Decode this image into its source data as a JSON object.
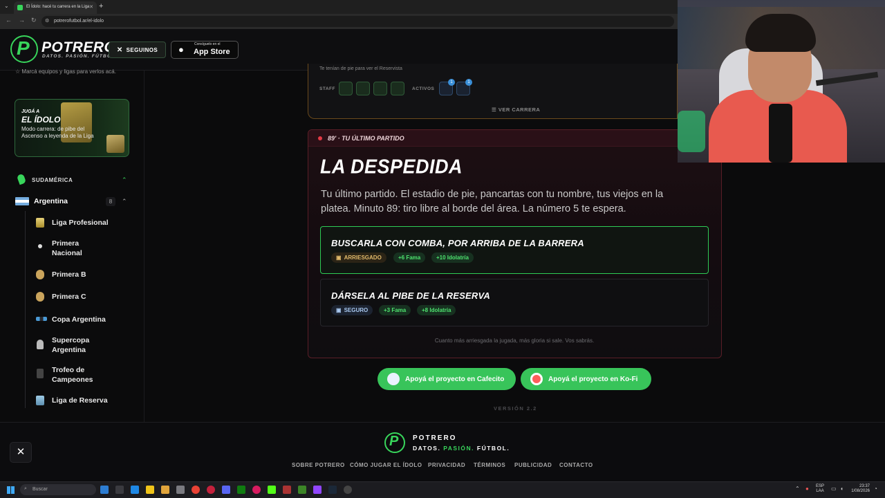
{
  "browser": {
    "tab_title": "El Ídolo: hacé tu carrera en la Liga",
    "url": "potrerofutbol.ar/el-idolo",
    "new_tab": "+"
  },
  "header": {
    "logo_letter": "P",
    "brand": "POTRERO",
    "tagline": "DATOS. PASIÓN. FÚTBOL.",
    "follow_label": "SEGUINOS",
    "appstore_small": "Consíguelo en el",
    "appstore_big": "App Store"
  },
  "sidebar": {
    "hint": "Marcá equipos y ligas para verlos acá.",
    "promo": {
      "pre": "JUGÁ A",
      "title": "EL ÍDOLO",
      "desc": "Modo carrera: de pibe del Ascenso a leyenda de la Liga"
    },
    "region": "SUDAMÉRICA",
    "country": "Argentina",
    "country_count": "8",
    "leagues": [
      {
        "label": "Liga Profesional"
      },
      {
        "label": "Primera Nacional"
      },
      {
        "label": "Primera B"
      },
      {
        "label": "Primera C"
      },
      {
        "label": "Copa Argentina"
      },
      {
        "label": "Supercopa Argentina"
      },
      {
        "label": "Trofeo de Campeones"
      },
      {
        "label": "Liga de Reserva"
      }
    ]
  },
  "career": {
    "top_text": "Te tenían de pie para ver el Reservista",
    "staff_label": "STAFF",
    "activos_label": "ACTIVOS",
    "badge_1": "1",
    "badge_2": "1",
    "ver_carrera": "VER CARRERA"
  },
  "match": {
    "minute": "89' · TU ÚLTIMO PARTIDO",
    "title": "LA DESPEDIDA",
    "description": "Tu último partido. El estadio de pie, pancartas con tu nombre, tus viejos en la platea. Minuto 89: tiro libre al borde del área. La número 5 te espera.",
    "options": [
      {
        "title": "BUSCARLA CON COMBA, POR ARRIBA DE LA BARRERA",
        "risk": "ARRIESGADO",
        "fame": "+6 Fama",
        "idolatria": "+10 Idolatría"
      },
      {
        "title": "DÁRSELA AL PIBE DE LA RESERVA",
        "risk": "SEGURO",
        "fame": "+3 Fama",
        "idolatria": "+8 Idolatría"
      }
    ],
    "hint": "Cuanto más arriesgada la jugada, más gloria si sale. Vos sabrás."
  },
  "support": {
    "cafecito": "Apoyá el proyecto en Cafecito",
    "kofi": "Apoyá el proyecto en Ko-Fi"
  },
  "version": "VERSIÓN 2.2",
  "footer": {
    "brand": "POTRERO",
    "tag_a": "DATOS.",
    "tag_b": "PASIÓN.",
    "tag_c": "FÚTBOL.",
    "links": [
      "SOBRE POTRERO",
      "CÓMO JUGAR EL ÍDOLO",
      "PRIVACIDAD",
      "TÉRMINOS",
      "PUBLICIDAD",
      "CONTACTO"
    ]
  },
  "taskbar": {
    "search": "Buscar",
    "lang_1": "ESP",
    "lang_2": "LAA",
    "time": "23:37",
    "date": "1/08/2026"
  },
  "colors": {
    "accent": "#38d55b",
    "danger": "#e33a45",
    "risk": "#e0b96a",
    "safe": "#a8c8ef"
  }
}
